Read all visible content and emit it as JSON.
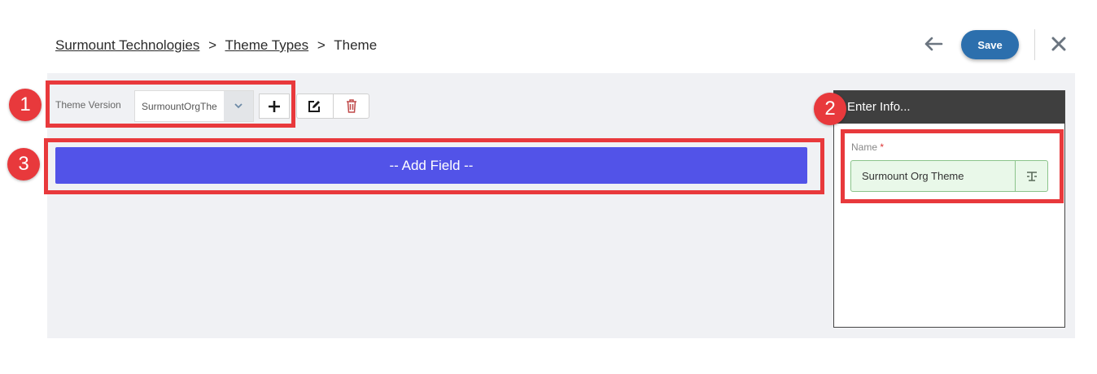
{
  "breadcrumb": {
    "items": [
      "Surmount Technologies",
      "Theme Types",
      "Theme"
    ],
    "separator": ">"
  },
  "header": {
    "save_label": "Save",
    "back_icon": "arrow-left-icon",
    "close_icon": "close-icon"
  },
  "toolbar": {
    "theme_version_label": "Theme Version",
    "theme_version_value": "SurmountOrgThe",
    "add_icon": "plus-icon",
    "edit_icon": "edit-icon",
    "delete_icon": "trash-icon"
  },
  "main": {
    "add_field_label": "-- Add Field --"
  },
  "panel": {
    "title": "Enter Info...",
    "name_label": "Name",
    "required_mark": "*",
    "name_value": "Surmount Org Theme"
  },
  "annotations": {
    "badges": [
      "1",
      "2",
      "3"
    ],
    "color": "#e8393c"
  },
  "colors": {
    "primary": "#2c6fad",
    "add_field": "#5253e8",
    "valid_field": "#e9f8e9",
    "panel_header": "#3f3f3f"
  }
}
